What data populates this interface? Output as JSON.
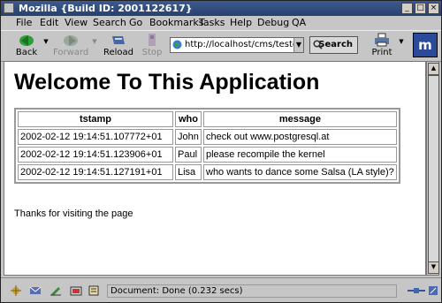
{
  "window": {
    "title": "Mozilla {Build ID: 2001122617}"
  },
  "menu": [
    "File",
    "Edit",
    "View",
    "Search",
    "Go",
    "Bookmarks",
    "Tasks",
    "Help",
    "Debug",
    "QA"
  ],
  "toolbar": {
    "back_label": "Back",
    "forward_label": "Forward",
    "reload_label": "Reload",
    "stop_label": "Stop",
    "url": "http://localhost/cms/testcms.p",
    "search_label": "Search",
    "print_label": "Print",
    "logo": "m"
  },
  "page": {
    "heading": "Welcome To This Application",
    "table": {
      "headers": [
        "tstamp",
        "who",
        "message"
      ],
      "rows": [
        [
          "2002-02-12 19:14:51.107772+01",
          "John",
          "check out www.postgresql.at"
        ],
        [
          "2002-02-12 19:14:51.123906+01",
          "Paul",
          "please recompile the kernel"
        ],
        [
          "2002-02-12 19:14:51.127191+01",
          "Lisa",
          "who wants to dance some Salsa (LA style)?"
        ]
      ]
    },
    "footer": "Thanks for visiting the page"
  },
  "status": {
    "text": "Document: Done (0.232 secs)"
  }
}
